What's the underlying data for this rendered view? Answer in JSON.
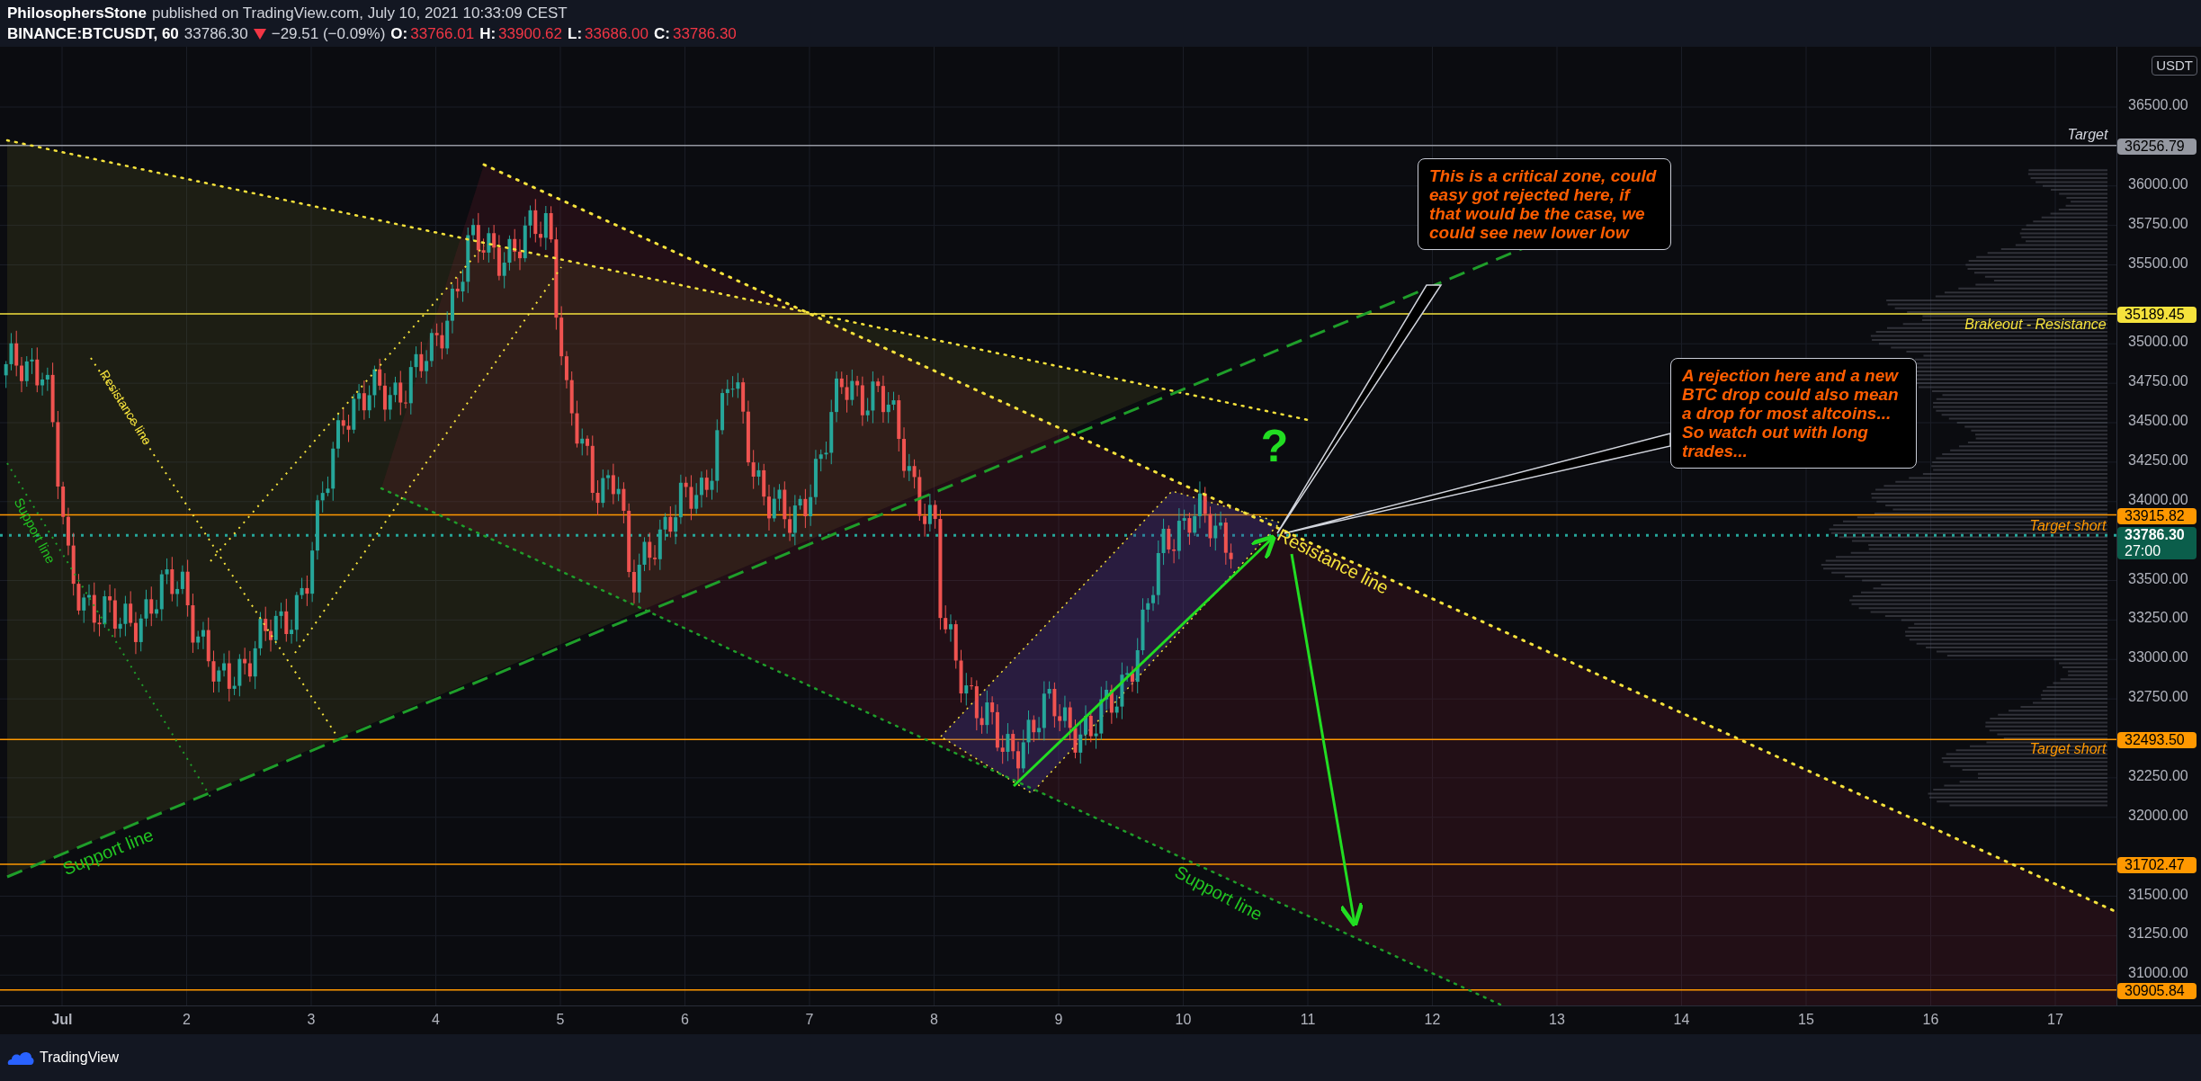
{
  "header": {
    "author": "PhilosophersStone",
    "published": "published on TradingView.com, July 10, 2021 10:33:09 CEST",
    "symbol": "BINANCE:BTCUSDT, 60",
    "price": "33786.30",
    "falling": true,
    "change": "−29.51 (−0.09%)",
    "ohlc": [
      {
        "label": "O:",
        "value": "33766.01"
      },
      {
        "label": "H:",
        "value": "33900.62"
      },
      {
        "label": "L:",
        "value": "33686.00"
      },
      {
        "label": "C:",
        "value": "33786.30"
      }
    ]
  },
  "price_axis": {
    "currency": "USDT",
    "ticks": [
      "36500.00",
      "36000.00",
      "35750.00",
      "35500.00",
      "35000.00",
      "34750.00",
      "34500.00",
      "34250.00",
      "34000.00",
      "33500.00",
      "33250.00",
      "33000.00",
      "32750.00",
      "32250.00",
      "32000.00",
      "31500.00",
      "31250.00",
      "31000.00"
    ],
    "markers": [
      {
        "value": "36256.79",
        "color": "#9598a1"
      },
      {
        "value": "35189.45",
        "color": "#f5e23c"
      },
      {
        "value": "33915.82",
        "color": "#ff9800"
      },
      {
        "value": "33786.30",
        "countdown": "27:00",
        "color": "#0b5e4b"
      },
      {
        "value": "32493.50",
        "color": "#ff9800"
      },
      {
        "value": "31702.47",
        "color": "#ff9800"
      },
      {
        "value": "30905.84",
        "color": "#ff9800"
      }
    ]
  },
  "annotations": [
    {
      "text": "Target",
      "color": "#d1d4dc"
    },
    {
      "text": "Brakeout - Resistance",
      "color": "#f5e23c"
    },
    {
      "text": "Target short",
      "color": "#ff9800"
    },
    {
      "text": "Target short",
      "color": "#ff9800"
    },
    {
      "text": "Resistance line",
      "color": "#f5e23c"
    },
    {
      "text": "Support line",
      "color": "#22c322"
    },
    {
      "text": "Support line",
      "color": "#22c322"
    },
    {
      "text": "Support line",
      "color": "#22c322"
    },
    {
      "text": "Resistance line",
      "color": "#f5e23c"
    },
    {
      "text": "?",
      "color": "#22dd22"
    }
  ],
  "callouts": [
    "This is a critical zone, could easy got rejected here, if that would be the case, we could see new lower low",
    "A rejection here and a new BTC drop could also mean a drop for most altcoins... So watch out with long trades..."
  ],
  "time_axis": [
    "Jul",
    "2",
    "3",
    "4",
    "5",
    "6",
    "7",
    "8",
    "9",
    "10",
    "11",
    "12",
    "13",
    "14",
    "15",
    "16",
    "17"
  ],
  "footer": {
    "brand": "TradingView"
  }
}
